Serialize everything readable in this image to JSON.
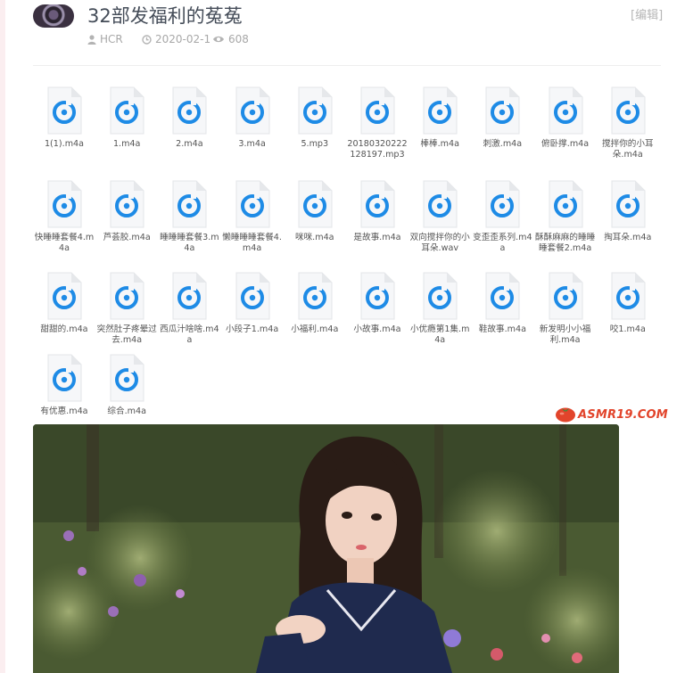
{
  "post": {
    "title": "32部发福利的菟菟",
    "edit_label": "[编辑]",
    "author": "HCR",
    "date": "2020-02-1",
    "views": "608"
  },
  "files": [
    "1(1).m4a",
    "1.m4a",
    "2.m4a",
    "3.m4a",
    "5.mp3",
    "20180320222128197.mp3",
    "棒棒.m4a",
    "刺激.m4a",
    "俯卧撑.m4a",
    "搅拌你的小耳朵.m4a",
    "快睡睡套餐4.m4a",
    "芦荟胶.m4a",
    "睡睡睡套餐3.m4a",
    "懒睡睡睡套餐4.m4a",
    "咪咪.m4a",
    "是故事.m4a",
    "双向搅拌你的小耳朵.wav",
    "变歪歪系列.m4a",
    "酥酥麻麻的睡睡睡套餐2.m4a",
    "掏耳朵.m4a",
    "甜甜的.m4a",
    "突然肚子疼晕过去.m4a",
    "西瓜汁啥啥.m4a",
    "小段子1.m4a",
    "小福利.m4a",
    "小故事.m4a",
    "小优瘾第1集.m4a",
    "鞋故事.m4a",
    "新发明小小福利.m4a",
    "咬1.m4a",
    "有优惠.m4a",
    "综合.m4a"
  ],
  "watermark": "ASMR19.COM",
  "colors": {
    "title": "#444c58",
    "meta": "#a8a8a8",
    "file_icon_blue": "#1e8be6",
    "watermark": "#e2442b"
  },
  "icons": {
    "author": "user-icon",
    "date": "clock-icon",
    "views": "eye-icon",
    "file": "audio-file-icon",
    "watermark_logo": "tomato-icon"
  }
}
